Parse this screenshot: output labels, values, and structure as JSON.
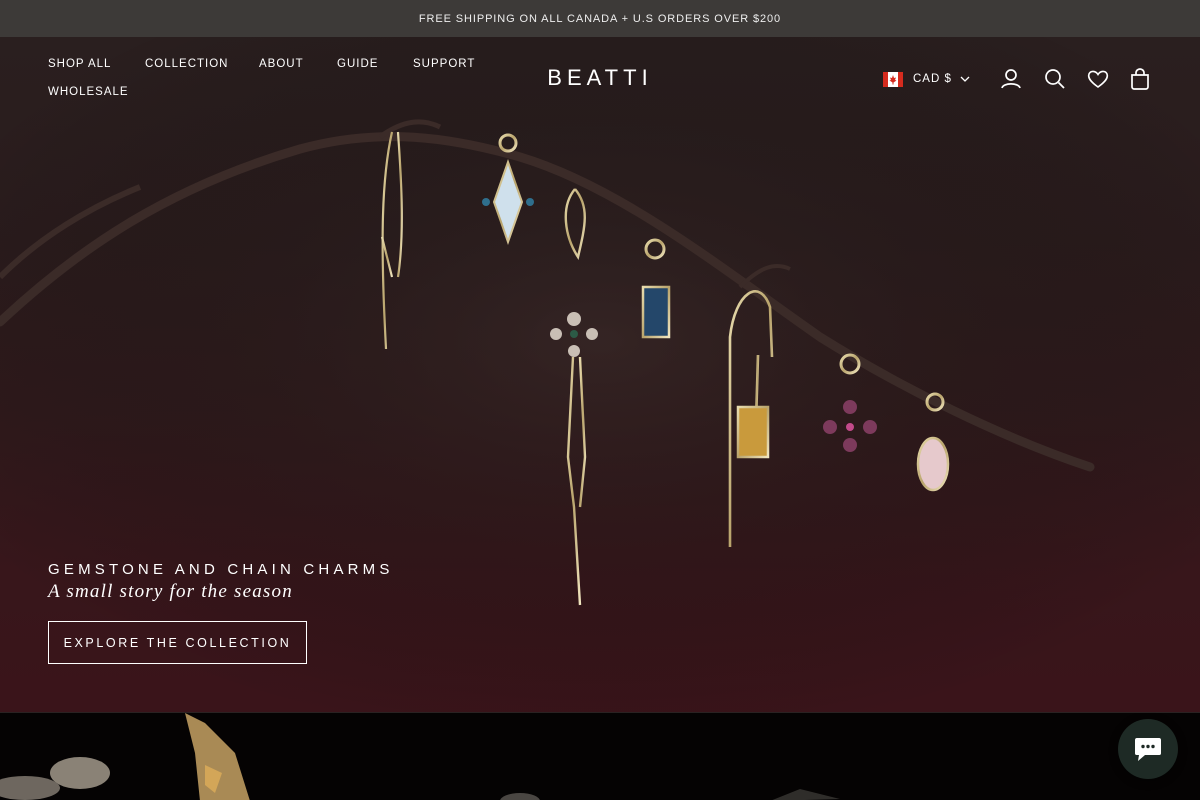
{
  "announcement": {
    "text": "FREE SHIPPING ON ALL CANADA + U.S ORDERS OVER $200"
  },
  "nav": {
    "items": [
      {
        "label": "SHOP ALL"
      },
      {
        "label": "COLLECTION"
      },
      {
        "label": "ABOUT"
      },
      {
        "label": "GUIDE"
      },
      {
        "label": "SUPPORT"
      },
      {
        "label": "WHOLESALE"
      }
    ]
  },
  "brand": {
    "logo": "BEATTI"
  },
  "header_tools": {
    "currency": "CAD $",
    "icons": [
      "account-icon",
      "search-icon",
      "wishlist-icon",
      "cart-icon"
    ]
  },
  "hero": {
    "headline": "GEMSTONE AND CHAIN CHARMS",
    "subline": "A small story for the season",
    "cta_label": "EXPLORE THE COLLECTION"
  },
  "colors": {
    "announcement_bg": "#3d3a38",
    "hero_bg": "#2b1c1d",
    "text": "#ffffff"
  }
}
